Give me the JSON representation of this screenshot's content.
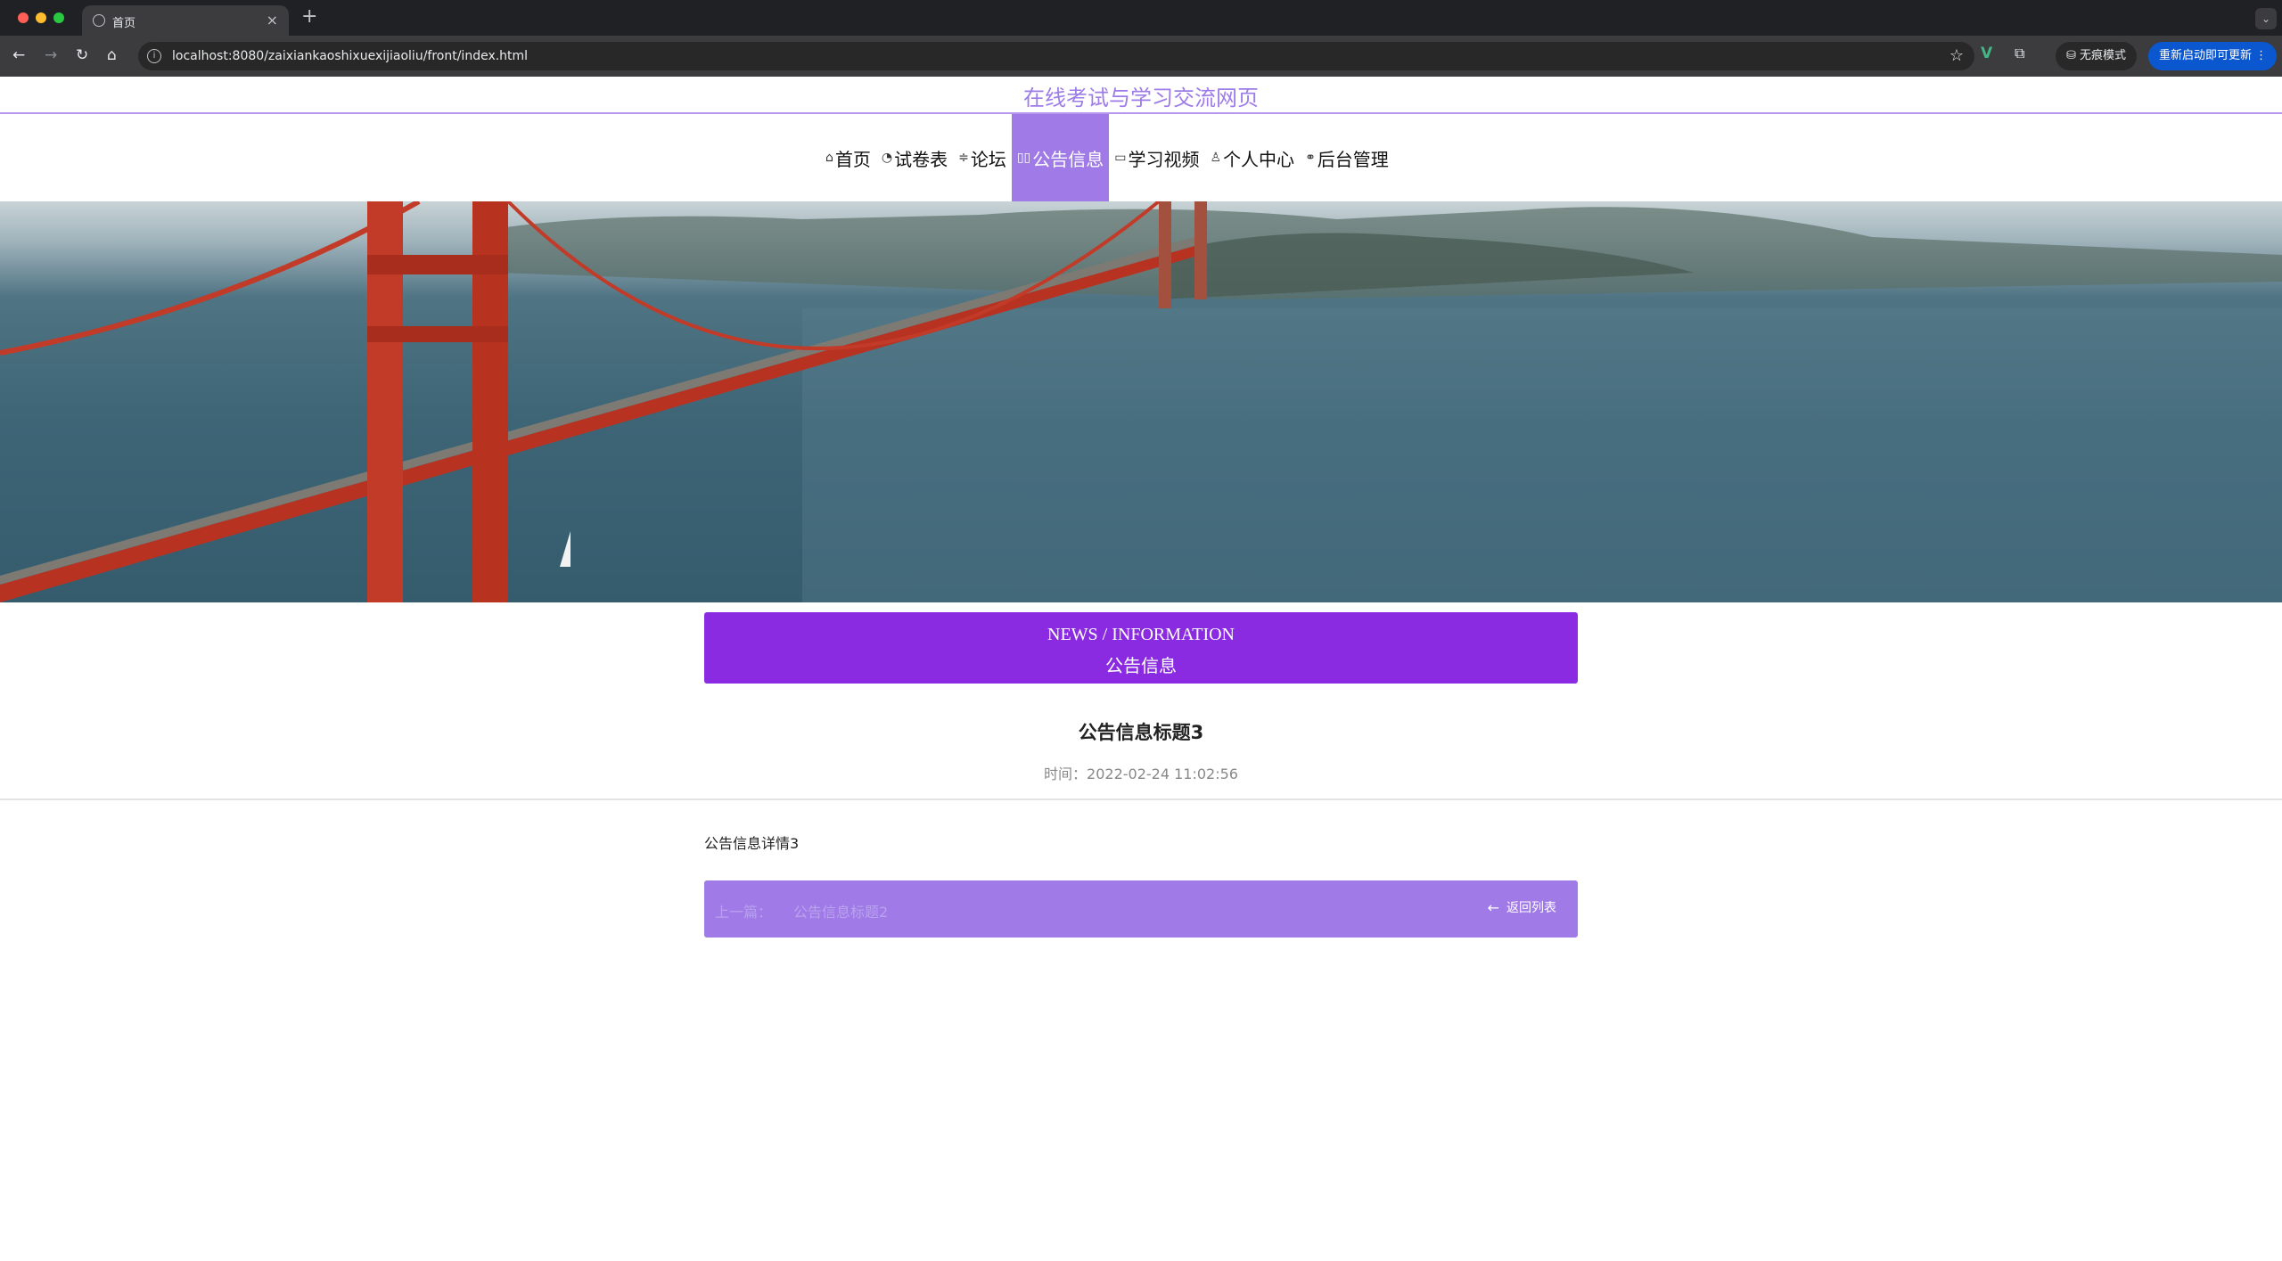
{
  "browser": {
    "tab_title": "首页",
    "new_tab": "+",
    "close_tab": "×",
    "url": "localhost:8080/zaixiankaoshixuexijiaoliu/front/index.html",
    "incognito_label": "无痕模式",
    "update_label": "重新启动即可更新"
  },
  "site": {
    "title": "在线考试与学习交流网页",
    "accent_color": "#a07ae6",
    "primary_color": "#8a2be2"
  },
  "nav": {
    "items": [
      {
        "label": "首页",
        "icon": "⌂"
      },
      {
        "label": "试卷表",
        "icon": "◔"
      },
      {
        "label": "论坛",
        "icon": "≑"
      },
      {
        "label": "公告信息",
        "icon": "▯▯",
        "active": true
      },
      {
        "label": "学习视频",
        "icon": "▭"
      },
      {
        "label": "个人中心",
        "icon": "♙"
      },
      {
        "label": "后台管理",
        "icon": "⚭"
      }
    ]
  },
  "banner": {
    "slides": 3,
    "active_slide": 1
  },
  "news": {
    "heading_en": "NEWS / INFORMATION",
    "heading_cn": "公告信息"
  },
  "article": {
    "title": "公告信息标题3",
    "time": "时间：2022-02-24 11:02:56",
    "body": "公告信息详情3"
  },
  "footer": {
    "prev_label": "上一篇：",
    "prev_title": "公告信息标题2",
    "back_label": "返回列表"
  }
}
